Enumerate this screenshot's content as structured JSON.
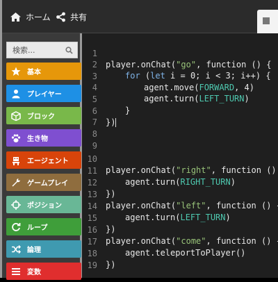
{
  "nav": {
    "home_label": "ホーム",
    "share_label": "共有"
  },
  "toolbox": {
    "search_placeholder": "検索...",
    "categories": [
      {
        "label": "基本",
        "color": "#e6970a",
        "icon": "star-icon"
      },
      {
        "label": "プレイヤー",
        "color": "#1e90e5",
        "icon": "person-icon"
      },
      {
        "label": "ブロック",
        "color": "#79b84a",
        "icon": "cube-icon"
      },
      {
        "label": "生き物",
        "color": "#7f4fd0",
        "icon": "paw-icon"
      },
      {
        "label": "エージェント",
        "color": "#d8440a",
        "icon": "robot-icon"
      },
      {
        "label": "ゲームプレイ",
        "color": "#8f6d3e",
        "icon": "wrench-icon"
      },
      {
        "label": "ポジション",
        "color": "#69b796",
        "icon": "crosshair-icon"
      },
      {
        "label": "ループ",
        "color": "#3f9e3a",
        "icon": "loop-icon"
      },
      {
        "label": "論理",
        "color": "#3f9ab0",
        "icon": "shuffle-icon"
      },
      {
        "label": "変数",
        "color": "#e02e2e",
        "icon": "list-icon"
      }
    ]
  },
  "editor": {
    "line_numbers": [
      "1",
      "2",
      "3",
      "4",
      "5",
      "6",
      "7",
      "8",
      "9",
      "10",
      "11",
      "12",
      "13",
      "14",
      "15",
      "16",
      "17",
      "18",
      "19"
    ],
    "tokens": {
      "player_onchat": "player.onChat(",
      "go": "\"go\"",
      "fn_open": ", function () {",
      "for_kw": "for",
      "for_open": " (",
      "let_kw": "let",
      "for_body": " i = 0; i < 3; i++) {",
      "agent_move": "agent.move(",
      "forward": "FORWARD",
      "move_tail": ", 4)",
      "agent_turn": "agent.turn(",
      "left_turn": "LEFT_TURN",
      "right_turn": "RIGHT_TURN",
      "close_paren": ")",
      "close_brace": "}",
      "close_block": "})",
      "right": "\"right\"",
      "left": "\"left\"",
      "come": "\"come\"",
      "teleport": "agent.teleportToPlayer()"
    }
  }
}
